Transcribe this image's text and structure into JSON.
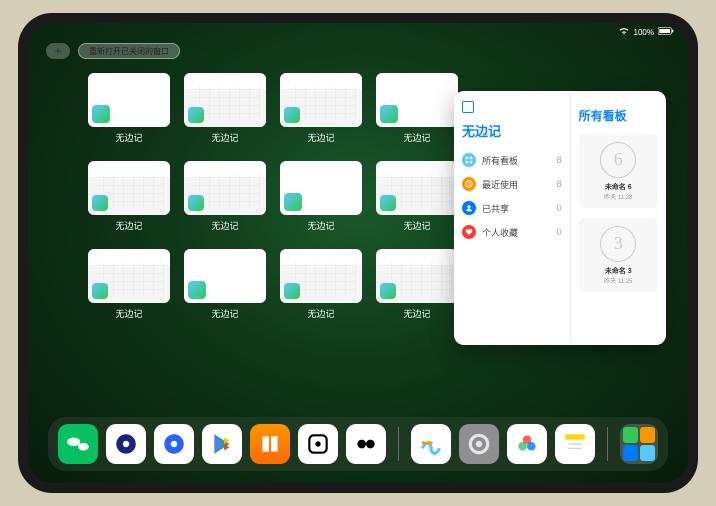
{
  "status": {
    "battery": "100%"
  },
  "top": {
    "reopen_label": "重新打开已关闭的窗口"
  },
  "thumbs": [
    {
      "label": "无边记",
      "kind": "blank"
    },
    {
      "label": "无边记",
      "kind": "calendar"
    },
    {
      "label": "无边记",
      "kind": "calendar"
    },
    {
      "label": "无边记",
      "kind": "blank"
    },
    {
      "label": "无边记",
      "kind": "calendar"
    },
    {
      "label": "无边记",
      "kind": "calendar"
    },
    {
      "label": "无边记",
      "kind": "blank"
    },
    {
      "label": "无边记",
      "kind": "calendar"
    },
    {
      "label": "无边记",
      "kind": "calendar"
    },
    {
      "label": "无边记",
      "kind": "blank"
    },
    {
      "label": "无边记",
      "kind": "calendar"
    },
    {
      "label": "无边记",
      "kind": "calendar"
    }
  ],
  "panel": {
    "left_title": "无边记",
    "right_title": "所有看板",
    "items": [
      {
        "icon": "grid",
        "color": "cyan",
        "label": "所有看板",
        "count": "8"
      },
      {
        "icon": "clock",
        "color": "orange",
        "label": "最近使用",
        "count": "8"
      },
      {
        "icon": "person",
        "color": "blue",
        "label": "已共享",
        "count": "0"
      },
      {
        "icon": "heart",
        "color": "red",
        "label": "个人收藏",
        "count": "0"
      }
    ],
    "boards": [
      {
        "sketch": "6",
        "name": "未命名 6",
        "sub": "昨天 11:28"
      },
      {
        "sketch": "3",
        "name": "未命名 3",
        "sub": "昨天 11:25"
      }
    ]
  },
  "dock": [
    {
      "name": "wechat",
      "bg": "#07c160"
    },
    {
      "name": "quark-hd",
      "bg": "#ffffff"
    },
    {
      "name": "quark",
      "bg": "#ffffff"
    },
    {
      "name": "play-store",
      "bg": "#ffffff"
    },
    {
      "name": "books",
      "bg": "linear-gradient(#ff9500,#ff6a00)"
    },
    {
      "name": "dice",
      "bg": "#ffffff"
    },
    {
      "name": "vision",
      "bg": "#ffffff"
    },
    {
      "name": "freeform",
      "bg": "#ffffff"
    },
    {
      "name": "settings",
      "bg": "#8e8e93"
    },
    {
      "name": "photos",
      "bg": "#ffffff"
    },
    {
      "name": "notes",
      "bg": "#ffffff"
    }
  ]
}
